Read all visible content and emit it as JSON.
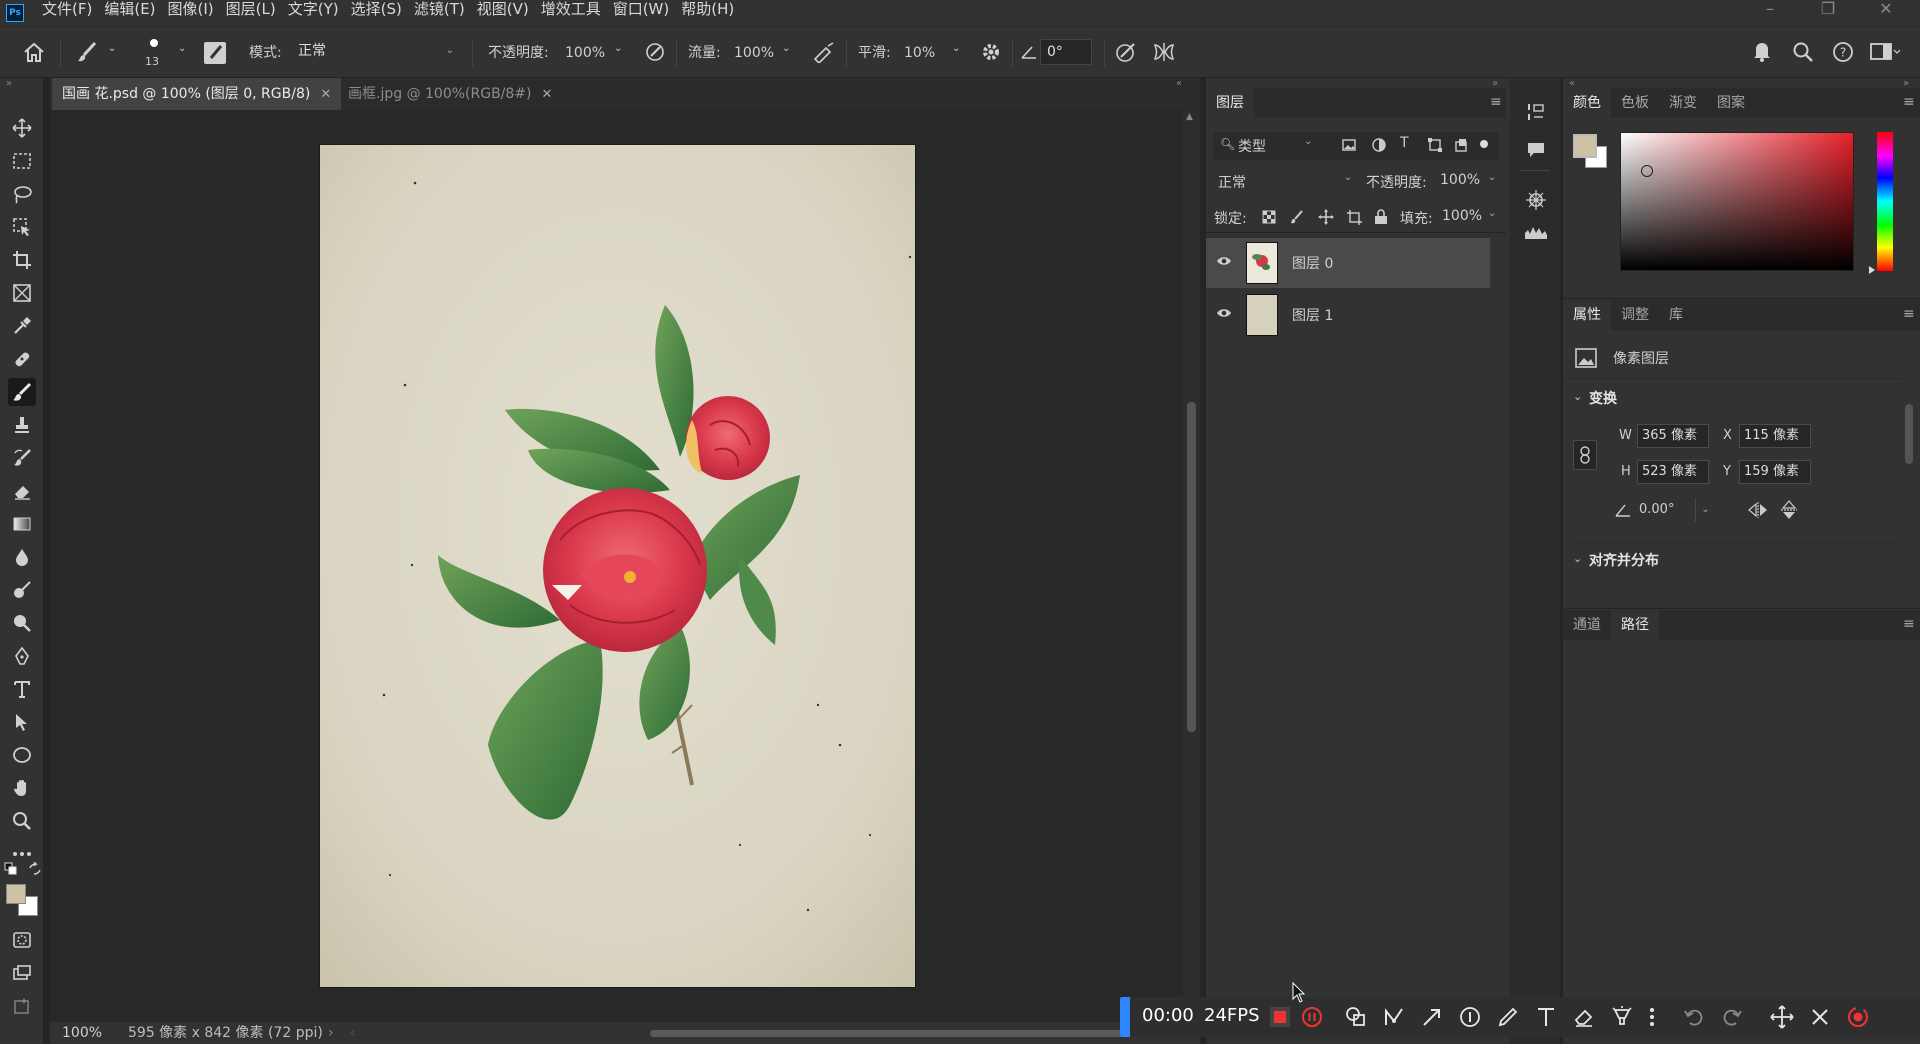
{
  "app": {
    "logo": "Ps"
  },
  "menu": [
    "文件(F)",
    "编辑(E)",
    "图像(I)",
    "图层(L)",
    "文字(Y)",
    "选择(S)",
    "滤镜(T)",
    "视图(V)",
    "增效工具",
    "窗口(W)",
    "帮助(H)"
  ],
  "options": {
    "brush_size": "13",
    "mode_label": "模式:",
    "mode_value": "正常",
    "opacity_label": "不透明度:",
    "opacity_value": "100%",
    "flow_label": "流量:",
    "flow_value": "100%",
    "smooth_label": "平滑:",
    "smooth_value": "10%",
    "angle_value": "0°"
  },
  "tabs": [
    {
      "label": "国画 花.psd @ 100% (图层 0, RGB/8)",
      "active": true
    },
    {
      "label": "画框.jpg @ 100%(RGB/8#)",
      "active": false
    }
  ],
  "status": {
    "zoom": "100%",
    "doc_size": "595 像素 x 842 像素 (72 ppi)"
  },
  "layers_panel": {
    "title": "图层",
    "filter_label": "类型",
    "blend_mode": "正常",
    "opacity_label": "不透明度:",
    "opacity_value": "100%",
    "lock_label": "锁定:",
    "fill_label": "填充:",
    "fill_value": "100%",
    "layers": [
      {
        "name": "图层 0",
        "selected": true
      },
      {
        "name": "图层 1",
        "selected": false
      }
    ]
  },
  "color_panel": {
    "tabs": [
      "颜色",
      "色板",
      "渐变",
      "图案"
    ],
    "foreground": "#cdc2a3",
    "background": "#ffffff",
    "hue": "#e8202a"
  },
  "properties_panel": {
    "tabs": [
      "属性",
      "调整",
      "库"
    ],
    "layer_type": "像素图层",
    "transform_title": "变换",
    "w_label": "W",
    "w_value": "365 像素",
    "x_label": "X",
    "x_value": "115 像素",
    "h_label": "H",
    "h_value": "523 像素",
    "y_label": "Y",
    "y_value": "159 像素",
    "angle_value": "0.00°",
    "align_title": "对齐并分布"
  },
  "paths_panel": {
    "tabs": [
      "通道",
      "路径"
    ]
  },
  "recorder": {
    "time": "00:00",
    "fps": "24FPS"
  }
}
